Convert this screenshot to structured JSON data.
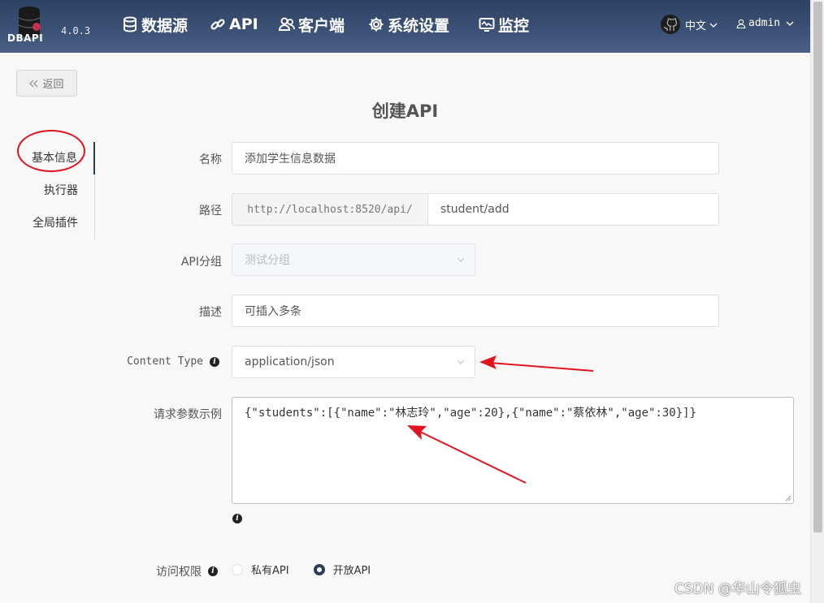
{
  "header": {
    "logo_text": "DBAPI",
    "version": "4.0.3",
    "nav": [
      {
        "label": "数据源",
        "icon": "database-icon"
      },
      {
        "label": "API",
        "icon": "link-icon"
      },
      {
        "label": "客户端",
        "icon": "users-icon"
      },
      {
        "label": "系统设置",
        "icon": "gear-icon"
      },
      {
        "label": "监控",
        "icon": "monitor-icon"
      }
    ],
    "language": "中文",
    "user": "admin"
  },
  "back_label": "返回",
  "title": "创建API",
  "side_tabs": [
    {
      "label": "基本信息",
      "active": true
    },
    {
      "label": "执行器",
      "active": false
    },
    {
      "label": "全局插件",
      "active": false
    }
  ],
  "form": {
    "name_label": "名称",
    "name_value": "添加学生信息数据",
    "path_label": "路径",
    "path_prefix": "http://localhost:8520/api/",
    "path_value": "student/add",
    "group_label": "API分组",
    "group_value": "测试分组",
    "desc_label": "描述",
    "desc_value": "可插入多条",
    "content_type_label": "Content Type",
    "content_type_value": "application/json",
    "param_example_label": "请求参数示例",
    "param_example_value": "{\"students\":[{\"name\":\"林志玲\",\"age\":20},{\"name\":\"蔡依林\",\"age\":30}]}",
    "access_label": "访问权限",
    "access_options": [
      {
        "label": "私有API",
        "checked": false
      },
      {
        "label": "开放API",
        "checked": true
      }
    ]
  },
  "annotation_color": "#e0141e",
  "watermark": "CSDN @华山令狐虫"
}
